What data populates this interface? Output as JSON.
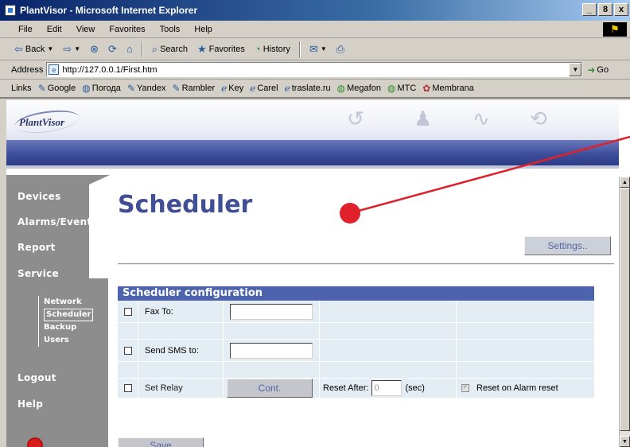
{
  "window": {
    "title": "PlantVisor - Microsoft Internet Explorer",
    "controls": [
      "_",
      "8",
      "x"
    ]
  },
  "menu": [
    "File",
    "Edit",
    "View",
    "Favorites",
    "Tools",
    "Help"
  ],
  "toolbar": {
    "back": "Back",
    "search": "Search",
    "favorites": "Favorites",
    "history": "History"
  },
  "address": {
    "label": "Address",
    "url": "http://127.0.0.1/First.htm",
    "go": "Go"
  },
  "links": {
    "label": "Links",
    "items": [
      "Google",
      "Погода",
      "Yandex",
      "Rambler",
      "Key",
      "Carel",
      "traslate.ru",
      "Megafon",
      "MTC",
      "Membrana"
    ]
  },
  "app": {
    "logo": "PlantVisor",
    "header_icons": [
      "refresh-icon",
      "alarm-bell-icon",
      "graph-icon",
      "rewind-icon"
    ]
  },
  "sidebar": {
    "items": [
      "Devices",
      "Alarms/Events",
      "Report",
      "Service"
    ],
    "service_sub": [
      "Network",
      "Scheduler",
      "Backup",
      "Users"
    ],
    "active_sub": "Scheduler",
    "bottom": [
      "Logout",
      "Help"
    ]
  },
  "main": {
    "title": "Scheduler",
    "settings_label": "Settings..",
    "config_header": "Scheduler configuration",
    "fax_label": "Fax To:",
    "sms_label": "Send SMS to:",
    "relay_label": "Set Relay",
    "cont_label": "Cont.",
    "reset_after_label": "Reset After:",
    "reset_after_value": "0",
    "sec_label": "(sec)",
    "reset_alarm_label": "Reset on Alarm reset",
    "save_label": "Save"
  },
  "colors": {
    "title_blue": "#414f95",
    "header_bar": "#3e4e9a",
    "table_head": "#4d63ad",
    "table_cell": "#e3edf3",
    "sidebar": "#8d8d8d",
    "annotation_red": "#e0202a"
  }
}
